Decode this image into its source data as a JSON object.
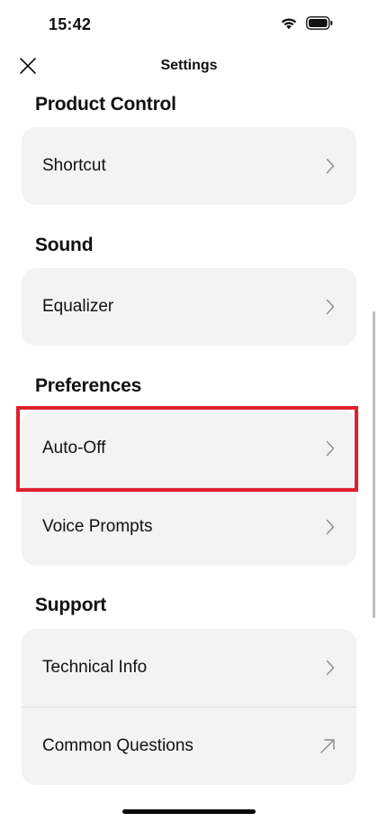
{
  "status_bar": {
    "time": "15:42"
  },
  "nav": {
    "title": "Settings"
  },
  "sections": [
    {
      "header": "Product Control",
      "items": [
        {
          "label": "Shortcut",
          "icon": "chevron-right-icon"
        }
      ]
    },
    {
      "header": "Sound",
      "items": [
        {
          "label": "Equalizer",
          "icon": "chevron-right-icon"
        }
      ]
    },
    {
      "header": "Preferences",
      "items": [
        {
          "label": "Auto-Off",
          "icon": "chevron-right-icon"
        },
        {
          "label": "Voice Prompts",
          "icon": "chevron-right-icon"
        }
      ]
    },
    {
      "header": "Support",
      "items": [
        {
          "label": "Technical Info",
          "icon": "chevron-right-icon"
        },
        {
          "label": "Common Questions",
          "icon": "external-arrow-icon"
        }
      ]
    }
  ],
  "colors": {
    "card_background": "#f3f3f3",
    "highlight": "#e0202e",
    "text": "#111111",
    "icon": "#8e8e93"
  }
}
